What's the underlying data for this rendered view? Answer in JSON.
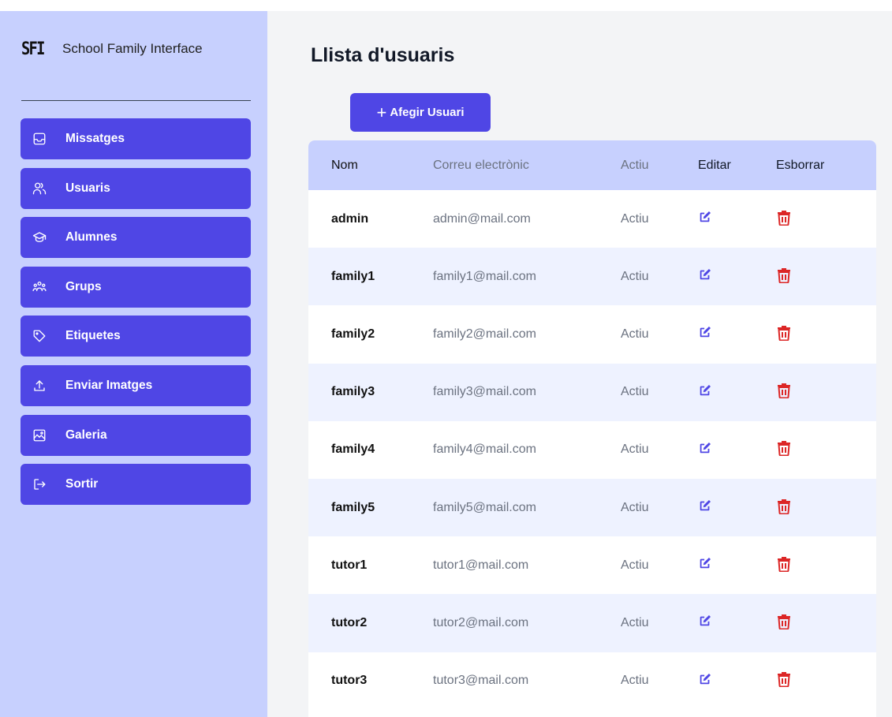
{
  "brand": {
    "logo": "SFI",
    "name": "School Family Interface"
  },
  "colors": {
    "accent": "#4f46e5",
    "sidebar": "#c7d0fe",
    "delete": "#dc2626"
  },
  "nav": {
    "items": [
      {
        "label": "Missatges",
        "icon": "inbox-icon"
      },
      {
        "label": "Usuaris",
        "icon": "users-icon"
      },
      {
        "label": "Alumnes",
        "icon": "graduation-cap-icon"
      },
      {
        "label": "Grups",
        "icon": "group-icon"
      },
      {
        "label": "Etiquetes",
        "icon": "tag-icon"
      },
      {
        "label": "Enviar Imatges",
        "icon": "upload-icon"
      },
      {
        "label": "Galeria",
        "icon": "image-icon"
      },
      {
        "label": "Sortir",
        "icon": "logout-icon"
      }
    ]
  },
  "main": {
    "title": "Llista d'usuaris",
    "add_button": {
      "icon": "plus-icon",
      "label": "Afegir Usuari"
    },
    "table": {
      "headers": {
        "nom": "Nom",
        "mail": "Correu electrònic",
        "actiu": "Actiu",
        "editar": "Editar",
        "esborrar": "Esborrar"
      },
      "rows": [
        {
          "nom": "admin",
          "mail": "admin@mail.com",
          "actiu": "Actiu"
        },
        {
          "nom": "family1",
          "mail": "family1@mail.com",
          "actiu": "Actiu"
        },
        {
          "nom": "family2",
          "mail": "family2@mail.com",
          "actiu": "Actiu"
        },
        {
          "nom": "family3",
          "mail": "family3@mail.com",
          "actiu": "Actiu"
        },
        {
          "nom": "family4",
          "mail": "family4@mail.com",
          "actiu": "Actiu"
        },
        {
          "nom": "family5",
          "mail": "family5@mail.com",
          "actiu": "Actiu"
        },
        {
          "nom": "tutor1",
          "mail": "tutor1@mail.com",
          "actiu": "Actiu"
        },
        {
          "nom": "tutor2",
          "mail": "tutor2@mail.com",
          "actiu": "Actiu"
        },
        {
          "nom": "tutor3",
          "mail": "tutor3@mail.com",
          "actiu": "Actiu"
        }
      ]
    }
  }
}
